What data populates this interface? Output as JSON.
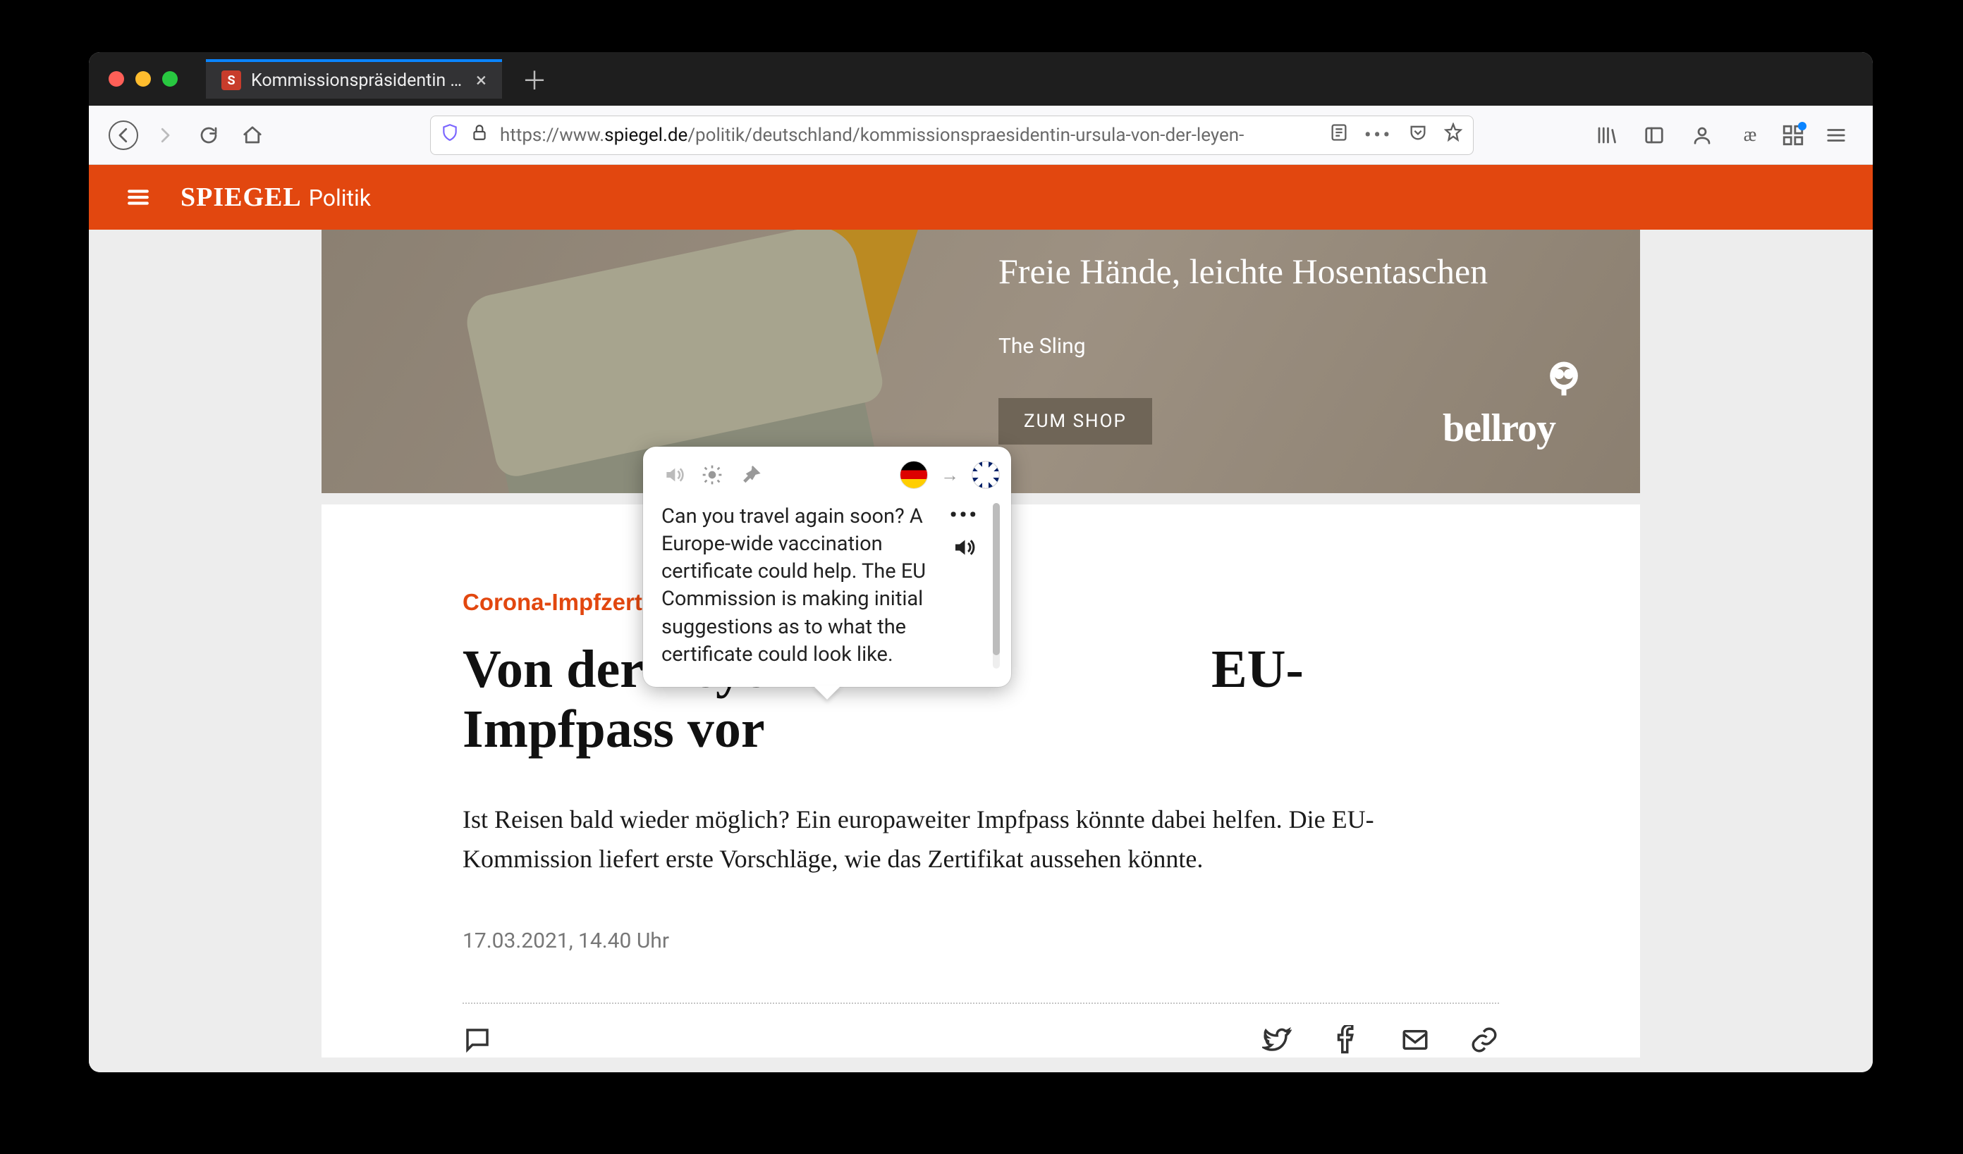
{
  "browser": {
    "tab_title": "Kommissionspräsidentin Ursula …",
    "url_prefix": "https://www.",
    "url_host": "spiegel.de",
    "url_path": "/politik/deutschland/kommissionspraesidentin-ursula-von-der-leyen-"
  },
  "site": {
    "brand": "SPIEGEL",
    "section": "Politik"
  },
  "ad": {
    "headline": "Freie Hände, leichte Hosentaschen",
    "sub": "The Sling",
    "button": "ZUM SHOP",
    "brand": "bellroy"
  },
  "article": {
    "kicker": "Corona-Impfzertifikat",
    "headline": "Von der Leyen                               EU-Impfpass vor",
    "lede": "Ist Reisen bald wieder möglich? Ein europaweiter Impfpass könnte dabei helfen. Die EU-Kommission liefert erste Vorschläge, wie das Zertifikat aussehen könnte.",
    "date": "17.03.2021, 14.40 Uhr"
  },
  "popup": {
    "translation": "Can you travel again soon? A Europe-wide vaccination certificate could help. The EU Commission is making initial suggestions as to what the certificate could look like.",
    "from_lang": "de",
    "to_lang": "en-gb"
  }
}
